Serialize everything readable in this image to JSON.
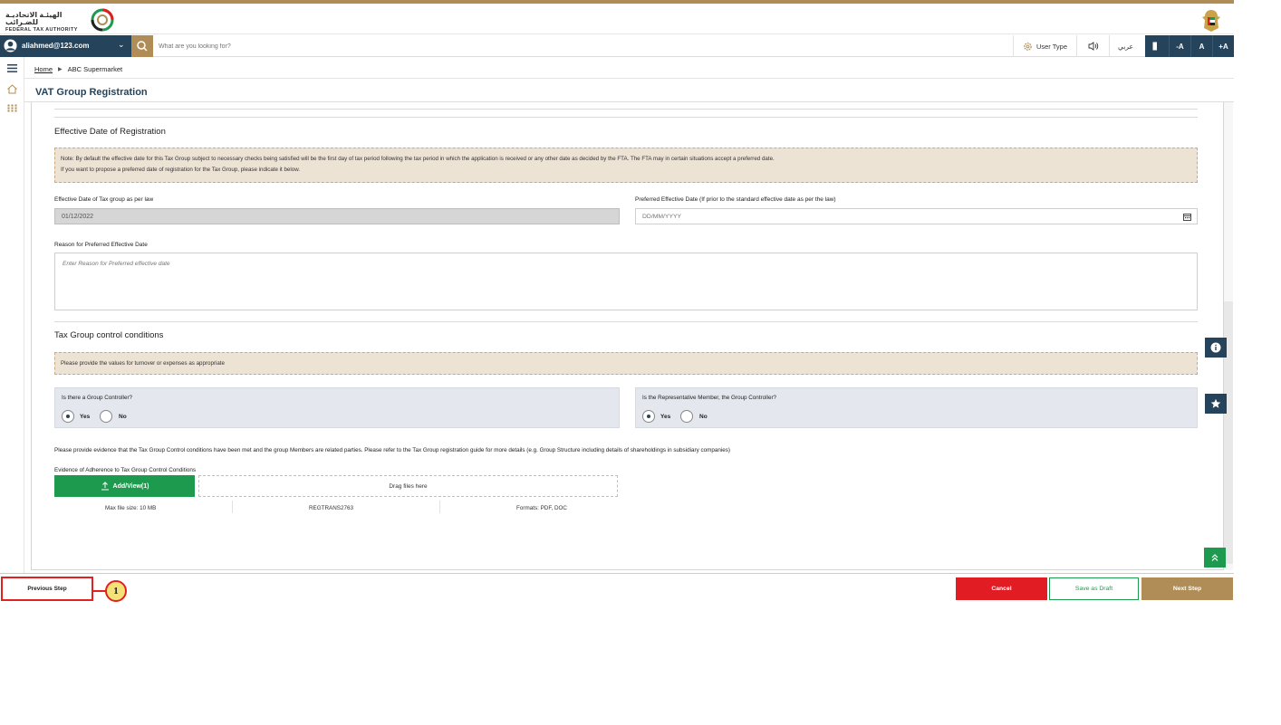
{
  "header": {
    "logo_ar": "الهيئـة الاتحاديـة للضـرائب",
    "logo_en": "FEDERAL TAX AUTHORITY"
  },
  "nav": {
    "user_email": "aliahmed@123.com",
    "search_placeholder": "What are you looking for?",
    "user_type_label": "User Type",
    "arabic_label": "عربي",
    "font_minus": "-A",
    "font_normal": "A",
    "font_plus": "+A"
  },
  "breadcrumb": {
    "home": "Home",
    "current": "ABC Supermarket"
  },
  "page": {
    "title": "VAT Group Registration"
  },
  "effective_date": {
    "section_title": "Effective Date of Registration",
    "note_line1": "Note: By default the effective date for this Tax Group subject to necessary checks being satisfied will be the first day of tax period following the tax period in which the application is received or any other date as decided by the FTA. The FTA may in certain situations accept a preferred date.",
    "note_line2": "If you want to propose a preferred date of registration for the Tax Group, please indicate it below.",
    "law_date_label": "Effective Date of Tax group as per law",
    "law_date_value": "01/12/2022",
    "preferred_label": "Preferred Effective Date (If prior to the standard effective date as per the law)",
    "preferred_placeholder": "DD/MM/YYYY",
    "reason_label": "Reason for Preferred Effective Date",
    "reason_placeholder": "Enter Reason for Preferred effective date"
  },
  "control": {
    "section_title": "Tax Group control conditions",
    "note": "Please provide the values for turnover or expenses as appropriate",
    "q1": "Is there a Group Controller?",
    "q2": "Is the Representative Member, the Group Controller?",
    "yes": "Yes",
    "no": "No",
    "q1_selected": "Yes",
    "q2_selected": "Yes",
    "evidence_text": "Please provide evidence that the Tax Group Control conditions have been met and the group Members are related parties. Please refer to the Tax Group registration guide for more details (e.g. Group Structure including details of shareholdings in subsidiary companies)",
    "evidence_label": "Evidence of Adherence to Tax Group Control Conditions",
    "upload_label": "Add/View(1)",
    "drop_label": "Drag files here",
    "max_size": "Max file size: 10 MB",
    "ref": "REGTRANS2763",
    "formats": "Formats: PDF, DOC"
  },
  "footer": {
    "previous": "Previous Step",
    "callout": "1",
    "cancel": "Cancel",
    "draft": "Save as Draft",
    "next": "Next Step"
  },
  "colors": {
    "navy": "#25435b",
    "gold": "#b08d57",
    "green": "#1e9a4f",
    "red": "#e21c23",
    "note_bg": "#ede3d4"
  }
}
